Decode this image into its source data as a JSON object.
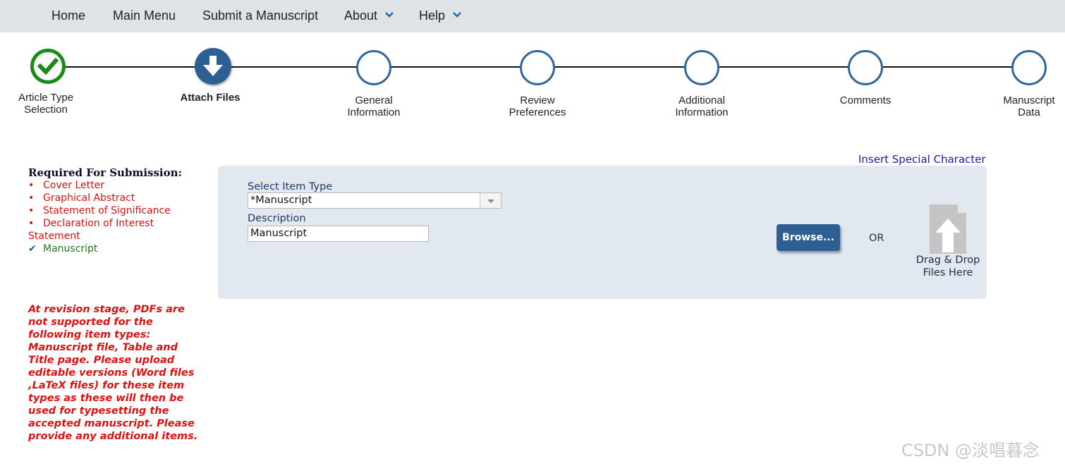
{
  "nav": {
    "home": "Home",
    "main_menu": "Main Menu",
    "submit": "Submit a Manuscript",
    "about": "About",
    "help": "Help"
  },
  "steps": [
    {
      "label": "Article Type\nSelection",
      "state": "completed"
    },
    {
      "label": "Attach Files",
      "state": "current"
    },
    {
      "label": "General\nInformation",
      "state": "pending"
    },
    {
      "label": "Review\nPreferences",
      "state": "pending"
    },
    {
      "label": "Additional\nInformation",
      "state": "pending"
    },
    {
      "label": "Comments",
      "state": "pending"
    },
    {
      "label": "Manuscript\nData",
      "state": "pending"
    }
  ],
  "special_char_link": "Insert Special Character",
  "required": {
    "title": "Required For Submission:",
    "missing": [
      "Cover Letter",
      "Graphical Abstract",
      "Statement of Significance",
      "Declaration of Interest Statement"
    ],
    "done": [
      "Manuscript"
    ]
  },
  "revision_note": "At revision stage, PDFs are not supported for the following item types: Manuscript file, Table and Title page. Please upload editable versions (Word files ,LaTeX files) for these item types as these will then be used for typesetting the accepted manuscript. Please provide any additional items.",
  "upload": {
    "item_type_label": "Select Item Type",
    "item_type_value": "*Manuscript",
    "description_label": "Description",
    "description_value": "Manuscript",
    "browse_label": "Browse...",
    "or_label": "OR",
    "drag_drop_label": "Drag & Drop\nFiles Here"
  },
  "watermark": "CSDN @淡唱暮念",
  "colors": {
    "nav_bg": "#dfe3e6",
    "accent": "#2e5f92",
    "completed": "#1a8a1a",
    "required_red": "#e01010",
    "panel_bg": "#e1e8f0"
  }
}
